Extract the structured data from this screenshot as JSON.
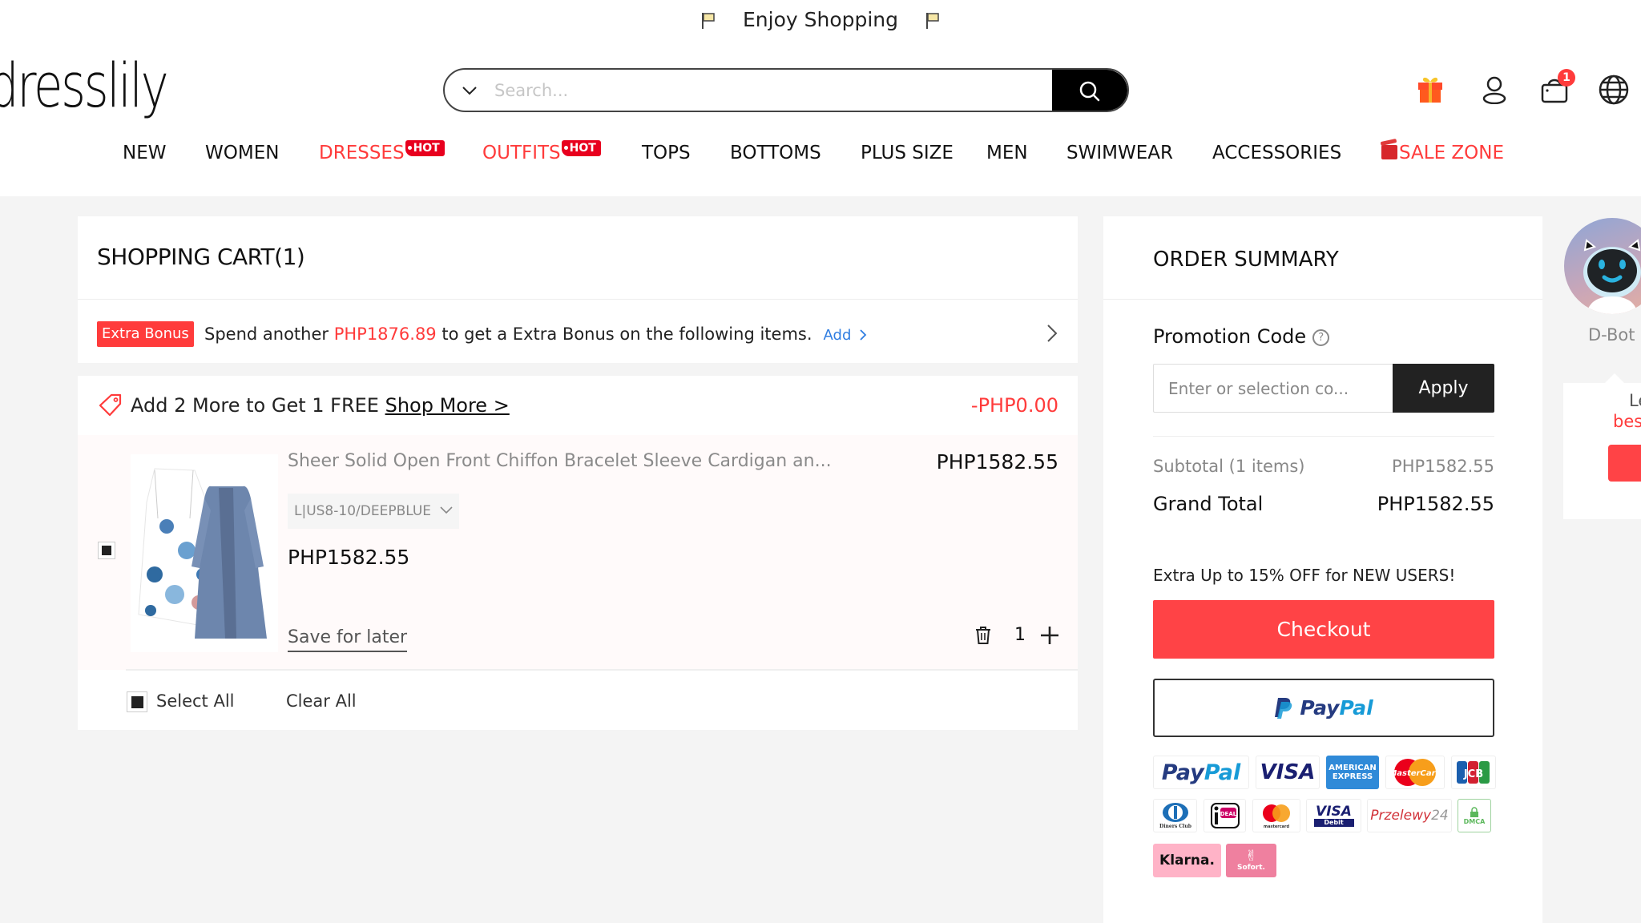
{
  "header": {
    "banner_text": "Enjoy Shopping",
    "logo": "dresslily",
    "search": {
      "placeholder": "Search...",
      "value": ""
    },
    "icons": [
      "gift-icon",
      "user-icon",
      "bag-icon",
      "globe-icon"
    ],
    "cart_badge": "1"
  },
  "nav": {
    "items": [
      {
        "label": "NEW"
      },
      {
        "label": "WOMEN"
      },
      {
        "label": "DRESSES",
        "badge": "HOT"
      },
      {
        "label": "OUTFITS",
        "badge": "HOT"
      },
      {
        "label": "TOPS"
      },
      {
        "label": "BOTTOMS"
      },
      {
        "label": "PLUS SIZE"
      },
      {
        "label": "MEN"
      },
      {
        "label": "SWIMWEAR"
      },
      {
        "label": "ACCESSORIES"
      },
      {
        "label": "SALE ZONE"
      }
    ]
  },
  "cart": {
    "title": "SHOPPING CART(1)",
    "bonus": {
      "tag": "Extra Bonus",
      "text_before": "Spend another ",
      "amount": "PHP1876.89",
      "text_after": " to get a Extra Bonus on the following items.",
      "add_label": "Add"
    },
    "promo": {
      "text": "Add 2 More to Get 1 FREE ",
      "link": "Shop More >",
      "amount": "-PHP0.00"
    },
    "items": [
      {
        "name": "Sheer Solid Open Front Chiffon Bracelet Sleeve Cardigan an...",
        "variant": "L|US8-10/DEEPBLUE",
        "price": "PHP1582.55",
        "line_total": "PHP1582.55",
        "quantity": "1",
        "save_label": "Save for later",
        "checked": true
      }
    ],
    "select_all_label": "Select All",
    "clear_all_label": "Clear All"
  },
  "summary": {
    "title": "ORDER SUMMARY",
    "promo_label": "Promotion Code",
    "promo_placeholder": "Enter or selection co...",
    "apply_label": "Apply",
    "subtotal_label": "Subtotal (1 items)",
    "subtotal_value": "PHP1582.55",
    "grand_total_label": "Grand Total",
    "grand_total_value": "PHP1582.55",
    "new_user_text": "Extra Up to 15% OFF for NEW USERS!",
    "checkout_label": "Checkout",
    "paypal": {
      "p1": "Pay",
      "p2": "Pal"
    },
    "payment_methods": [
      "PayPal",
      "VISA",
      "American Express",
      "MasterCard",
      "JCB",
      "Diners Club",
      "iDEAL",
      "mastercard",
      "VISA Debit",
      "Przelewy24",
      "DMCA",
      "Klarna.",
      "Sofort."
    ]
  },
  "dbot": {
    "label": "D-Bot",
    "popup_line1": "Le",
    "popup_line2": "bes"
  },
  "colors": {
    "accent_red": "#ff3b3b",
    "checkout": "#ff4346",
    "dark": "#222222",
    "link_blue": "#2f7de1"
  }
}
